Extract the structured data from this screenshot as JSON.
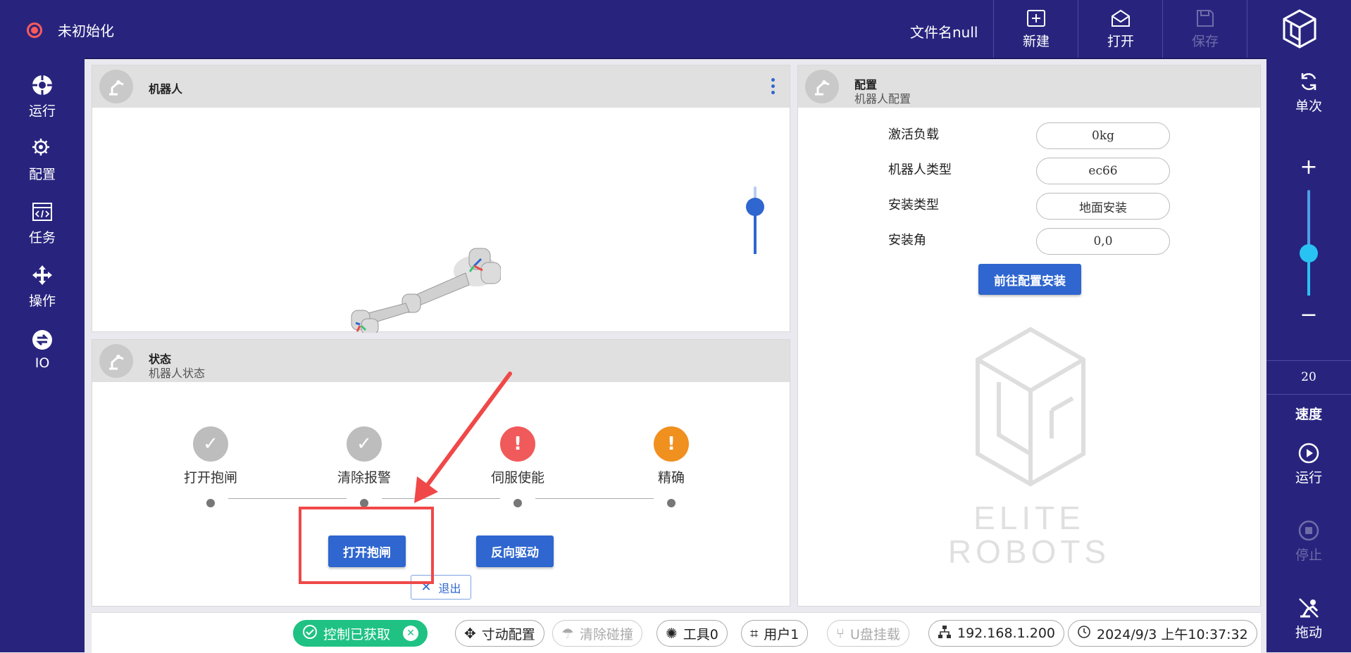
{
  "topbar": {
    "status": "未初始化",
    "filename": "文件名null",
    "new_label": "新建",
    "open_label": "打开",
    "save_label": "保存"
  },
  "leftnav": {
    "items": [
      {
        "label": "运行",
        "icon": "run-target-icon"
      },
      {
        "label": "配置",
        "icon": "config-gear-icon"
      },
      {
        "label": "任务",
        "icon": "task-code-icon"
      },
      {
        "label": "操作",
        "icon": "move-arrows-icon"
      },
      {
        "label": "IO",
        "icon": "io-exchange-icon"
      }
    ]
  },
  "rightnav": {
    "single_label": "单次",
    "plus": "+",
    "minus": "−",
    "speed_value": "20",
    "speed_label": "速度",
    "run_label": "运行",
    "stop_label": "停止",
    "drag_label": "拖动",
    "speed_slider_level": 0.4
  },
  "robot_panel": {
    "title": "机器人",
    "zoom_slider_level": 0.7
  },
  "config_panel": {
    "title": "配置",
    "subtitle": "机器人配置",
    "rows": [
      {
        "label": "激活负载",
        "value": "0kg"
      },
      {
        "label": "机器人类型",
        "value": "ec66"
      },
      {
        "label": "安装类型",
        "value": "地面安装"
      },
      {
        "label": "安装角",
        "value": "0,0"
      }
    ],
    "goto_button": "前往配置安装",
    "watermark_line1": "ELITE",
    "watermark_line2": "ROBOTS"
  },
  "status_panel": {
    "title": "状态",
    "subtitle": "机器人状态",
    "steps": [
      {
        "label": "打开抱闸",
        "state": "done",
        "color": "#bdbdbd",
        "glyph": "✓"
      },
      {
        "label": "清除报警",
        "state": "done",
        "color": "#bdbdbd",
        "glyph": "✓"
      },
      {
        "label": "伺服使能",
        "state": "error",
        "color": "#f15a5a",
        "glyph": "!"
      },
      {
        "label": "精确",
        "state": "warning",
        "color": "#f0901f",
        "glyph": "!"
      }
    ],
    "open_brake_button": "打开抱闸",
    "reverse_drive_button": "反向驱动",
    "exit_button": "退出"
  },
  "bottombar": {
    "control": "控制已获取",
    "jog_config": "寸动配置",
    "clear_collision": "清除碰撞",
    "tool": "工具0",
    "user": "用户1",
    "usb": "U盘挂载",
    "ip": "192.168.1.200",
    "datetime": "2024/9/3 上午10:37:32"
  },
  "colors": {
    "nav_bg": "#28247e",
    "accent_blue": "#2f66cf",
    "annotation_red": "#f04848",
    "control_green": "#1fc283"
  }
}
